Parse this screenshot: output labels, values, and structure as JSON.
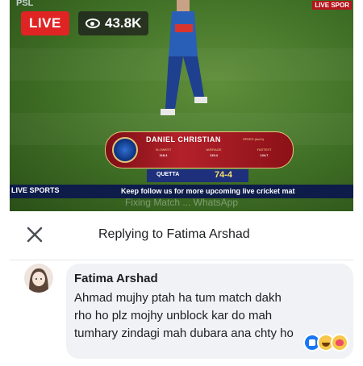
{
  "video": {
    "live_label": "LIVE",
    "viewer_count": "43.8K",
    "psl_logo": "PSL",
    "corner_logo": "LIVE SPOR",
    "stats_card": {
      "player_name": "DANIEL CHRISTIAN",
      "subtitle": "SPEED (km/h)",
      "columns": [
        {
          "label": "SLOWEST",
          "value": "118.4"
        },
        {
          "label": "AVERAGE",
          "value": "119.4"
        },
        {
          "label": "FASTEST",
          "value": "124.7"
        }
      ]
    },
    "score": {
      "team": "QUETTA",
      "runs": "74-4"
    },
    "ticker": {
      "logo": "LIVE SPORTS",
      "text": "Keep follow us for more upcoming live cricket mat"
    },
    "faded_text": "Fixing Match ... WhatsApp"
  },
  "reply": {
    "title": "Replying to Fatima Arshad",
    "comment": {
      "author": "Fatima Arshad",
      "text": "Ahmad mujhy ptah ha tum match dakh rho ho plz mojhy unblock kar do mah tumhary zindagi mah dubara ana chty ho"
    },
    "reactions": [
      "like-reaction-icon",
      "haha-reaction-icon",
      "care-reaction-icon"
    ]
  },
  "colors": {
    "live": "#e02424",
    "score_bar": "#1e2f7c",
    "bubble": "#f0f2f5"
  }
}
